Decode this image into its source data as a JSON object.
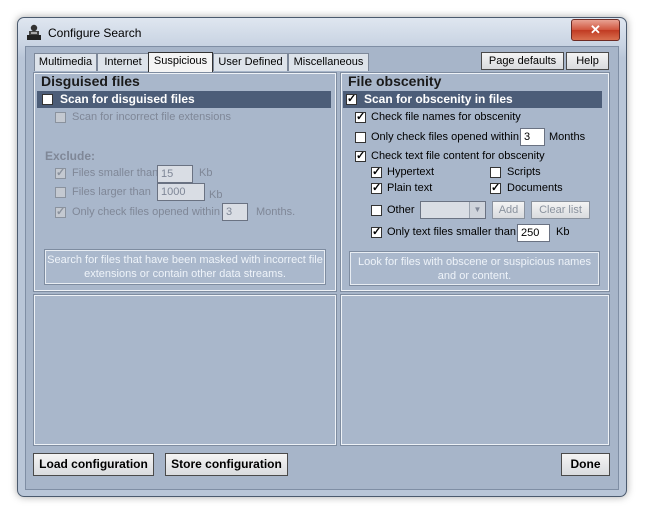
{
  "window": {
    "title": "Configure Search",
    "close_glyph": "✕",
    "icon": "app-icon"
  },
  "tabs": [
    {
      "label": "Multimedia"
    },
    {
      "label": "Internet"
    },
    {
      "label": "Suspicious",
      "active": true
    },
    {
      "label": "User Defined"
    },
    {
      "label": "Miscellaneous"
    }
  ],
  "toolbar": {
    "page_defaults": "Page defaults",
    "help": "Help"
  },
  "disguised": {
    "title": "Disguised files",
    "scan_label": "Scan for disguised files",
    "scan_checked": false,
    "incorrect_ext": "Scan for incorrect file extensions",
    "exclude": "Exclude:",
    "smaller_label": "Files smaller than",
    "smaller_value": "15",
    "smaller_unit": "Kb",
    "larger_label": "Files larger than",
    "larger_value": "1000",
    "larger_unit": "Kb",
    "opened_label": "Only check files opened within",
    "opened_value": "3",
    "opened_unit": "Months.",
    "description": "Search for files that have been masked with incorrect file extensions or contain other data streams."
  },
  "obscenity": {
    "title": "File obscenity",
    "scan_label": "Scan for obscenity in files",
    "names_label": "Check file names for obscenity",
    "opened_label": "Only check files opened within",
    "opened_value": "3",
    "opened_unit": "Months",
    "content_label": "Check text file content for obscenity",
    "hypertext": "Hypertext",
    "scripts": "Scripts",
    "plain": "Plain text",
    "documents": "Documents",
    "other": "Other",
    "add": "Add",
    "clear": "Clear list",
    "smaller_label": "Only text files smaller than",
    "smaller_value": "250",
    "smaller_unit": "Kb",
    "description": "Look for files with obscene or suspicious names and or content."
  },
  "footer": {
    "load": "Load configuration",
    "store": "Store configuration",
    "done": "Done"
  },
  "colors": {
    "header_bar": "#4c5d78",
    "client_bg": "#a7b5c9",
    "close": "#c13a22"
  }
}
